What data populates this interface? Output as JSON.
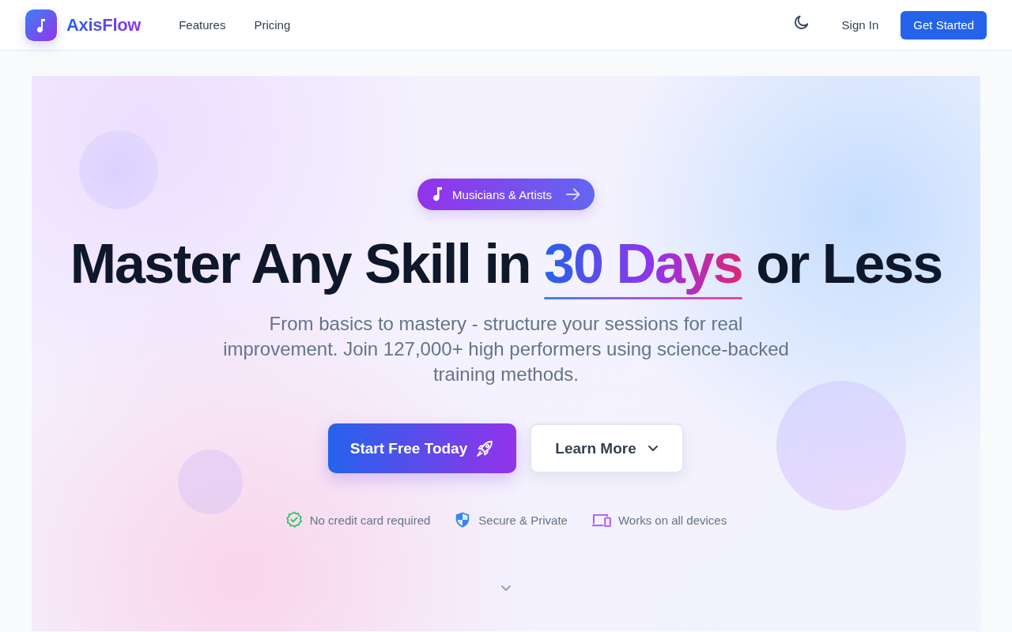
{
  "header": {
    "brand": "AxisFlow",
    "nav": [
      {
        "label": "Features"
      },
      {
        "label": "Pricing"
      }
    ],
    "sign_in": "Sign In",
    "cta": "Get Started"
  },
  "hero": {
    "badge": "Musicians & Artists",
    "headline": {
      "before": "Master Any Skill in ",
      "highlight": "30 Days",
      "after": " or Less"
    },
    "subtitle": "From basics to mastery - structure your sessions for real improvement. Join 127,000+ high performers using science-backed training methods.",
    "primary_button": "Start Free Today",
    "secondary_button": "Learn More",
    "features": [
      {
        "kind": "check",
        "label": "No credit card required"
      },
      {
        "kind": "shield",
        "label": "Secure & Private"
      },
      {
        "kind": "devices",
        "label": "Works on all devices"
      }
    ]
  }
}
